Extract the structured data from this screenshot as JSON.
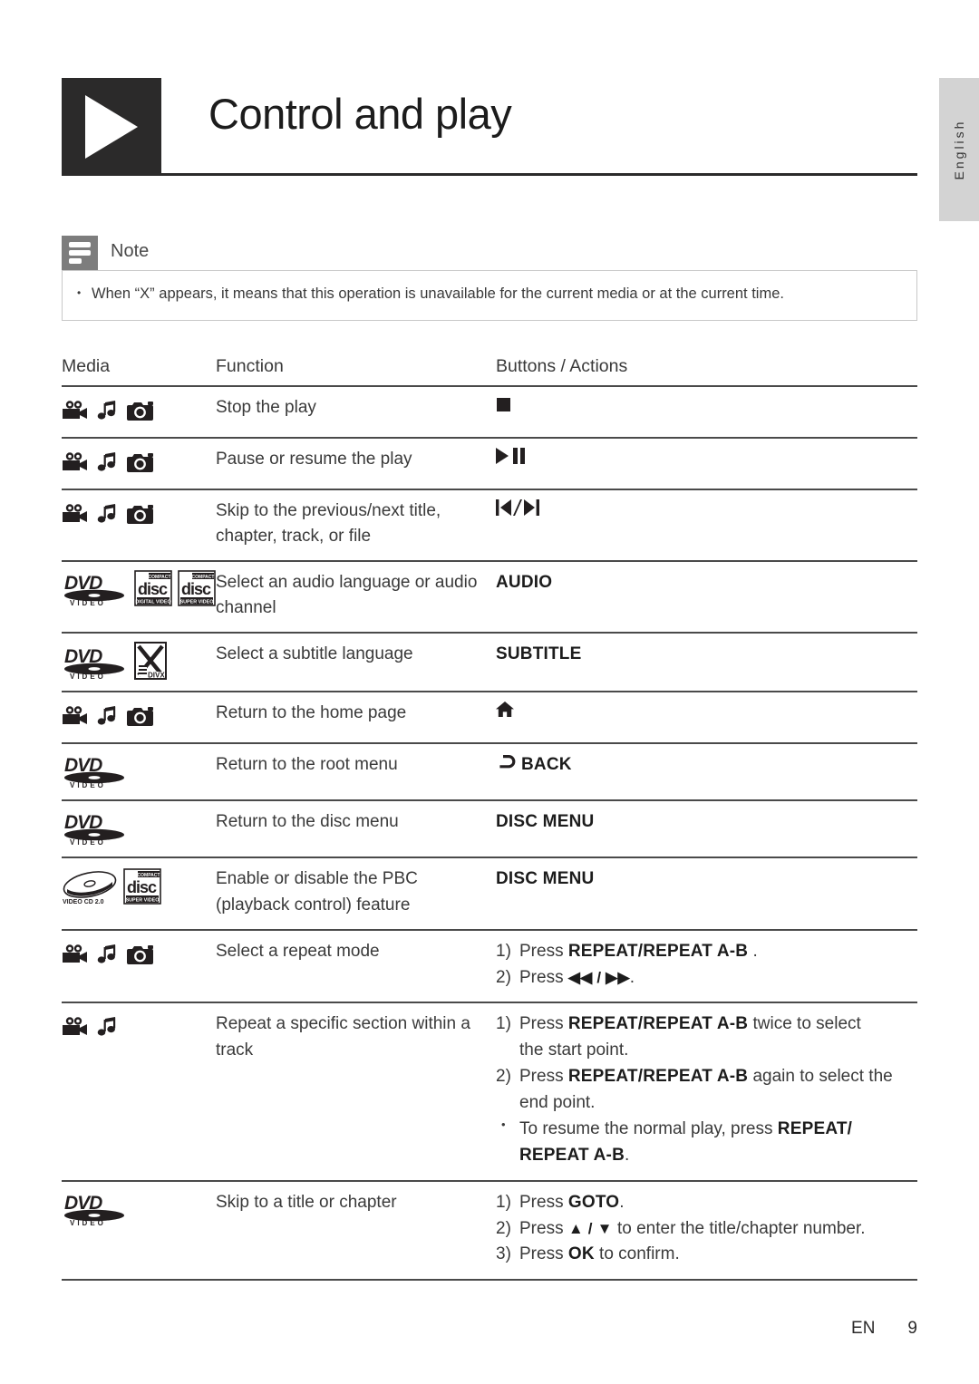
{
  "side_tab": {
    "label": "English"
  },
  "header": {
    "title": "Control and play",
    "badge_icon": "play-triangle-icon"
  },
  "note": {
    "label": "Note",
    "icon": "note-lines-icon",
    "items": [
      "When “X” appears, it means that this operation is unavailable for the current media or at the current time."
    ],
    "bullet": "•"
  },
  "table": {
    "headers": {
      "media": "Media",
      "function": "Function",
      "buttons": "Buttons / Actions"
    },
    "rows": [
      {
        "media_icons": [
          "camcorder-icon",
          "music-note-icon",
          "photo-camera-icon"
        ],
        "function": "Stop the play",
        "buttons_plain": "■",
        "buttons_kind": "glyph-stop"
      },
      {
        "media_icons": [
          "camcorder-icon",
          "music-note-icon",
          "photo-camera-icon"
        ],
        "function": "Pause or resume the play",
        "buttons_plain": "▶❙❙",
        "buttons_kind": "glyph-playpause"
      },
      {
        "media_icons": [
          "camcorder-icon",
          "music-note-icon",
          "photo-camera-icon"
        ],
        "function": "Skip to the previous/next title, chapter, track, or file",
        "buttons_plain": "⏮/⏭",
        "buttons_kind": "glyph-prevnext"
      },
      {
        "media_icons": [
          "dvd-video-logo",
          "compact-disc-digital-video-logo",
          "compact-disc-super-video-logo"
        ],
        "function": "Select an audio language or audio channel",
        "buttons_plain": "AUDIO",
        "buttons_kind": "key"
      },
      {
        "media_icons": [
          "dvd-video-logo",
          "divx-logo"
        ],
        "function": "Select a subtitle language",
        "buttons_plain": "SUBTITLE",
        "buttons_kind": "key"
      },
      {
        "media_icons": [
          "camcorder-icon",
          "music-note-icon",
          "photo-camera-icon"
        ],
        "function": "Return to the home page",
        "buttons_plain": "⌂",
        "buttons_kind": "glyph-home"
      },
      {
        "media_icons": [
          "dvd-video-logo"
        ],
        "function": "Return to the root menu",
        "buttons_plain": "↩ BACK",
        "buttons_kind": "glyph-back"
      },
      {
        "media_icons": [
          "dvd-video-logo"
        ],
        "function": "Return to the disc menu",
        "buttons_plain": "DISC MENU",
        "buttons_kind": "key"
      },
      {
        "media_icons": [
          "video-cd-2-0-logo",
          "compact-disc-super-video-logo"
        ],
        "function": "Enable or disable the PBC (playback control) feature",
        "buttons_plain": "DISC MENU",
        "buttons_kind": "key"
      },
      {
        "media_icons": [
          "camcorder-icon",
          "music-note-icon",
          "photo-camera-icon"
        ],
        "function": "Select a repeat mode",
        "buttons_kind": "steps-repeat-mode",
        "steps": [
          {
            "n": "1)",
            "pre": "Press ",
            "key": "REPEAT/REPEAT A-B",
            "post": " ."
          },
          {
            "n": "2)",
            "pre": "Press ",
            "key": "◀◀ / ▶▶",
            "post": "."
          }
        ]
      },
      {
        "media_icons": [
          "camcorder-icon",
          "music-note-icon"
        ],
        "function": "Repeat a specific section within a track",
        "buttons_kind": "steps-repeat-ab",
        "steps": [
          {
            "n": "1)",
            "pre": "Press ",
            "key": "REPEAT/REPEAT A-B",
            "post": "  twice to select",
            "cont": "the start point."
          },
          {
            "n": "2)",
            "pre": "Press ",
            "key": "REPEAT/REPEAT A-B",
            "post": " again to select the",
            "cont": "end point."
          },
          {
            "n": "•",
            "pre": "To resume the normal play, press ",
            "key": "REPEAT/",
            "post": "",
            "cont_key": "REPEAT A-B",
            "cont_post": "."
          }
        ]
      },
      {
        "media_icons": [
          "dvd-video-logo"
        ],
        "function": "Skip to a title or chapter",
        "buttons_kind": "steps-goto",
        "steps": [
          {
            "n": "1)",
            "pre": "Press ",
            "key": "GOTO",
            "post": "."
          },
          {
            "n": "2)",
            "pre": "Press ",
            "key": "▲ / ▼",
            "post": " to enter the title/chapter number."
          },
          {
            "n": "3)",
            "pre": "Press ",
            "key": "OK",
            "post": " to confirm."
          }
        ]
      }
    ]
  },
  "footer": {
    "lang": "EN",
    "page": "9"
  },
  "colors": {
    "ink": "#231f20",
    "rule": "#4a4a4a",
    "badge": "#2b2a2a",
    "note_icon_bg": "#7d7d7d",
    "side_tab_bg": "#d3d3d3"
  }
}
